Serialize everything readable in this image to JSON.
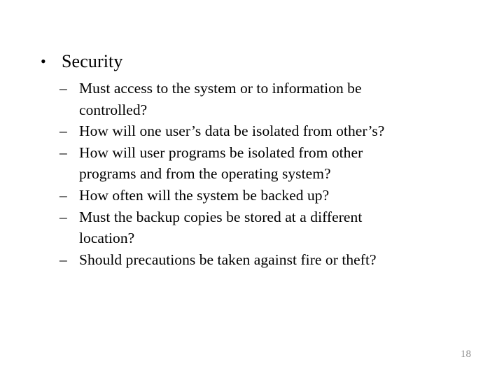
{
  "slide": {
    "background_color": "#ffffff",
    "text_color": "#000000",
    "bullet_marker_level1": "•",
    "bullet_marker_level2": "–",
    "main_bullet": {
      "label": "Security"
    },
    "sub_bullets": [
      {
        "label": "Must access to the system or to information be controlled?"
      },
      {
        "label": "How will one user’s data be isolated from other’s?"
      },
      {
        "label": "How will user programs be isolated from other programs and from the operating system?"
      },
      {
        "label": "How often will the system be backed up?"
      },
      {
        "label": "Must the backup copies be stored at a different location?"
      },
      {
        "label": "Should precautions be taken against fire or theft?"
      }
    ],
    "page_number": {
      "value": "18",
      "color": "#8c8c8c"
    }
  }
}
